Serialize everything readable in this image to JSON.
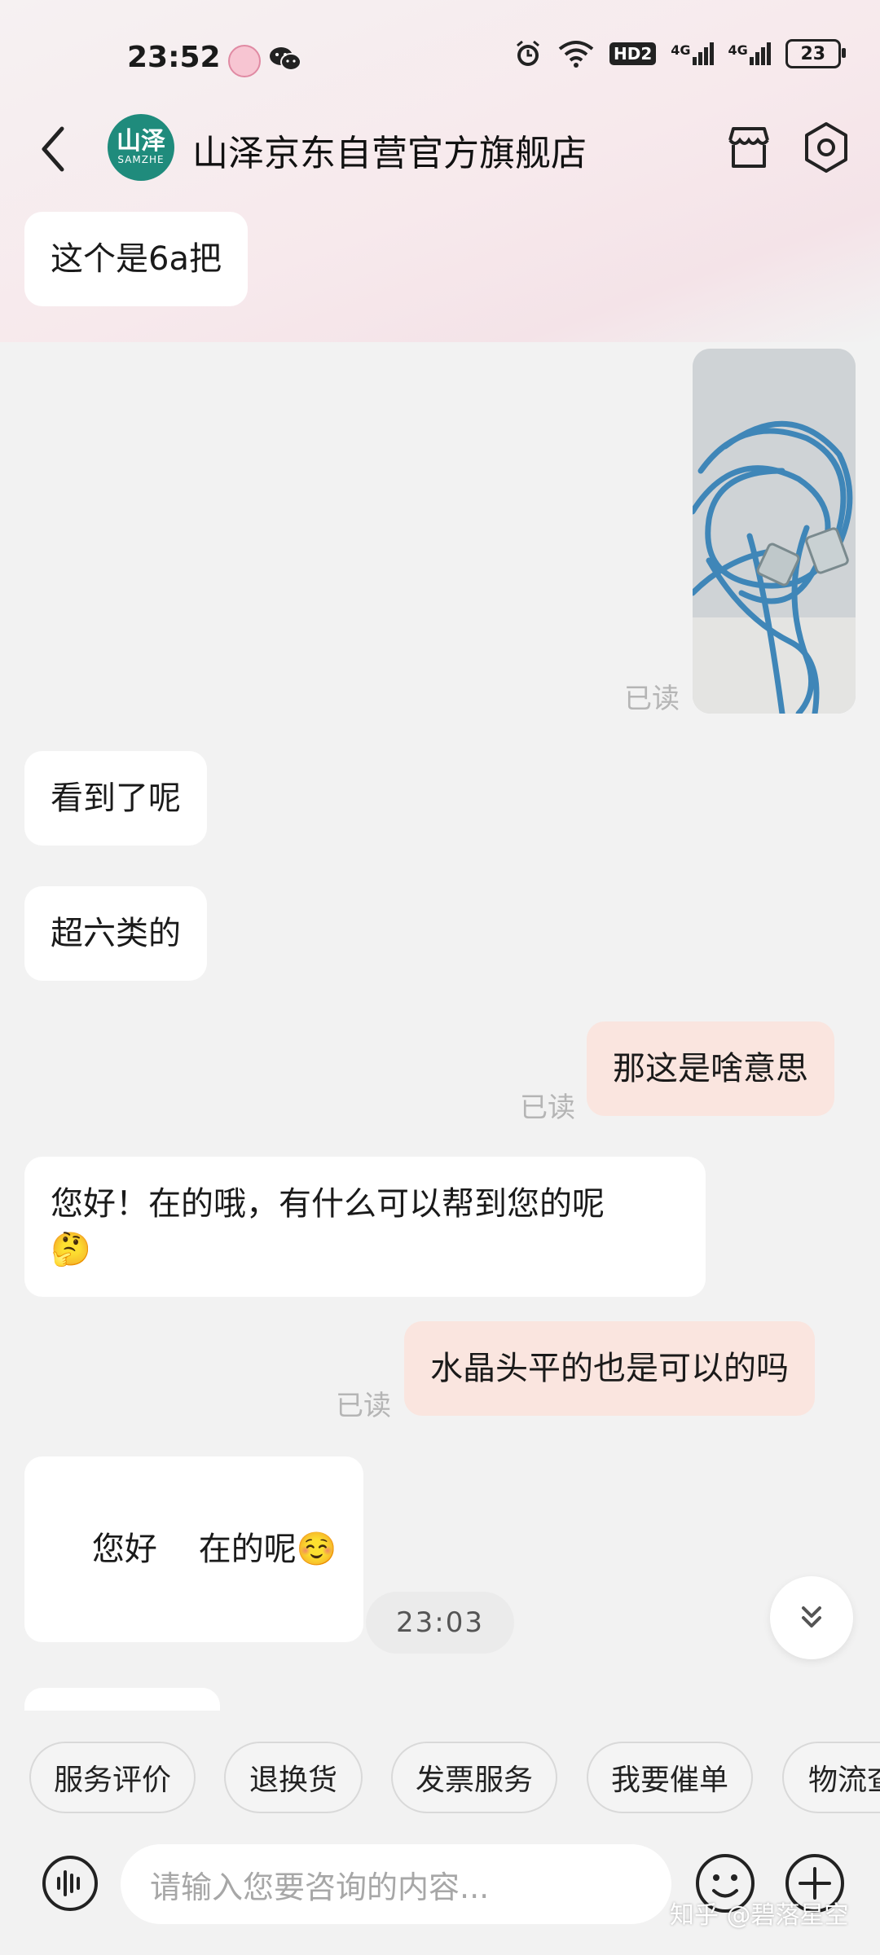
{
  "status": {
    "time": "23:52",
    "battery": "23",
    "network_label": "HD2",
    "signal_1": "4G",
    "signal_2": "4G"
  },
  "header": {
    "logo_cn": "山泽",
    "logo_en": "SAMZHE",
    "title": "山泽京东自营官方旗舰店"
  },
  "messages": [
    {
      "side": "in",
      "text": "这个是6a把"
    },
    {
      "side": "out",
      "type": "image",
      "read": "已读"
    },
    {
      "side": "in",
      "text": "看到了呢"
    },
    {
      "side": "in",
      "text": "超六类的"
    },
    {
      "side": "out",
      "text": "那这是啥意思",
      "read": "已读"
    },
    {
      "side": "in",
      "text": "您好！在的哦，有什么可以帮到您的呢",
      "emoji": "🤔"
    },
    {
      "side": "out",
      "text": "水晶头平的也是可以的吗",
      "read": "已读"
    },
    {
      "side": "in",
      "text": "您好    在的呢",
      "emoji": "☺️"
    }
  ],
  "timestamp": "23:03",
  "quick_actions": [
    "服务评价",
    "退换货",
    "发票服务",
    "我要催单",
    "物流查"
  ],
  "input": {
    "placeholder": "请输入您要咨询的内容..."
  },
  "watermark": "知乎 @碧落星空",
  "colors": {
    "accent_logo": "#1f8b7c",
    "outgoing_bubble": "#fae5df",
    "incoming_bubble": "#ffffff"
  }
}
